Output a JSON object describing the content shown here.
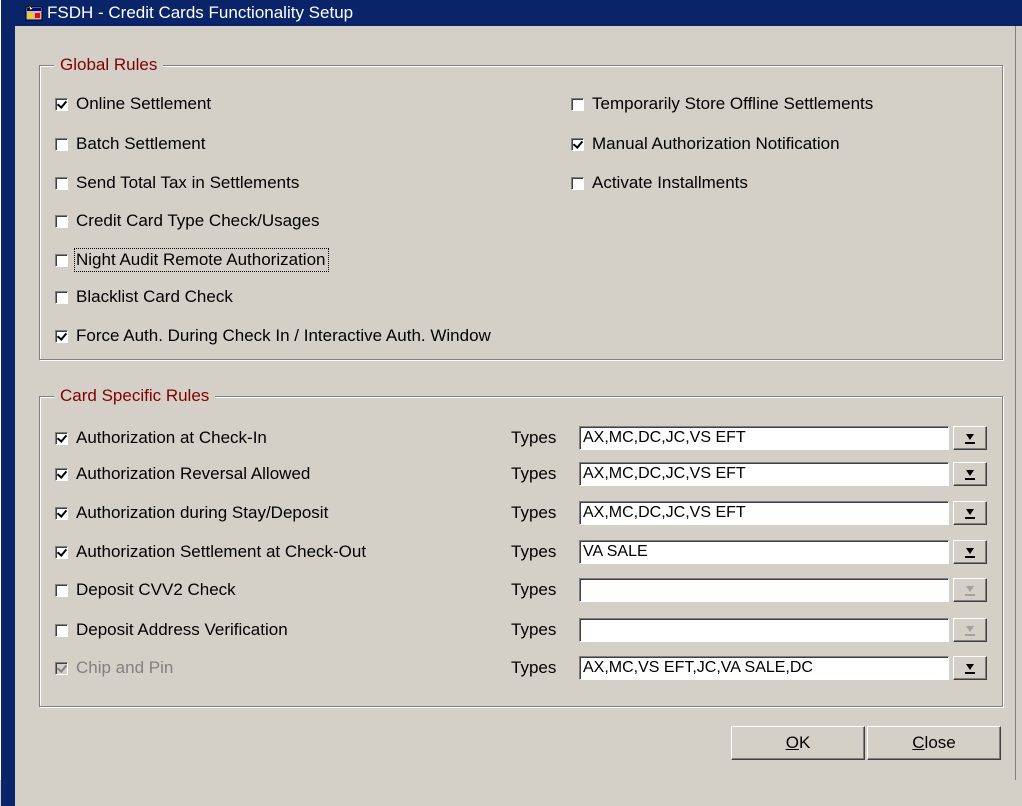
{
  "window": {
    "title": "FSDH - Credit Cards Functionality Setup"
  },
  "global_rules": {
    "title": "Global Rules",
    "left": [
      {
        "label": "Online Settlement",
        "checked": true
      },
      {
        "label": "Batch Settlement",
        "checked": false
      },
      {
        "label": "Send Total Tax in Settlements",
        "checked": false
      },
      {
        "label": "Credit Card Type Check/Usages",
        "checked": false
      },
      {
        "label": "Night Audit Remote Authorization",
        "checked": false
      },
      {
        "label": "Blacklist Card Check",
        "checked": false
      },
      {
        "label": "Force Auth. During Check In / Interactive Auth. Window",
        "checked": true
      }
    ],
    "right": [
      {
        "label": "Temporarily Store Offline Settlements",
        "checked": false
      },
      {
        "label": "Manual  Authorization Notification",
        "checked": true
      },
      {
        "label": "Activate Installments",
        "checked": false
      }
    ]
  },
  "card_rules": {
    "title": "Card Specific Rules",
    "types_label": "Types",
    "rows": [
      {
        "label": "Authorization at Check-In",
        "checked": true,
        "types": "AX,MC,DC,JC,VS EFT",
        "enabled": true
      },
      {
        "label": "Authorization Reversal Allowed",
        "checked": true,
        "types": "AX,MC,DC,JC,VS EFT",
        "enabled": true
      },
      {
        "label": "Authorization during Stay/Deposit",
        "checked": true,
        "types": "AX,MC,DC,JC,VS EFT",
        "enabled": true
      },
      {
        "label": "Authorization Settlement at Check-Out",
        "checked": true,
        "types": "VA SALE",
        "enabled": true
      },
      {
        "label": "Deposit CVV2 Check",
        "checked": false,
        "types": "",
        "enabled": false
      },
      {
        "label": "Deposit Address Verification",
        "checked": false,
        "types": "",
        "enabled": false
      },
      {
        "label": "Chip and Pin",
        "checked": true,
        "types": "AX,MC,VS EFT,JC,VA SALE,DC",
        "enabled": true,
        "label_disabled": true
      }
    ]
  },
  "buttons": {
    "ok_first": "O",
    "ok_rest": "K",
    "close_first": "C",
    "close_rest": "lose"
  }
}
